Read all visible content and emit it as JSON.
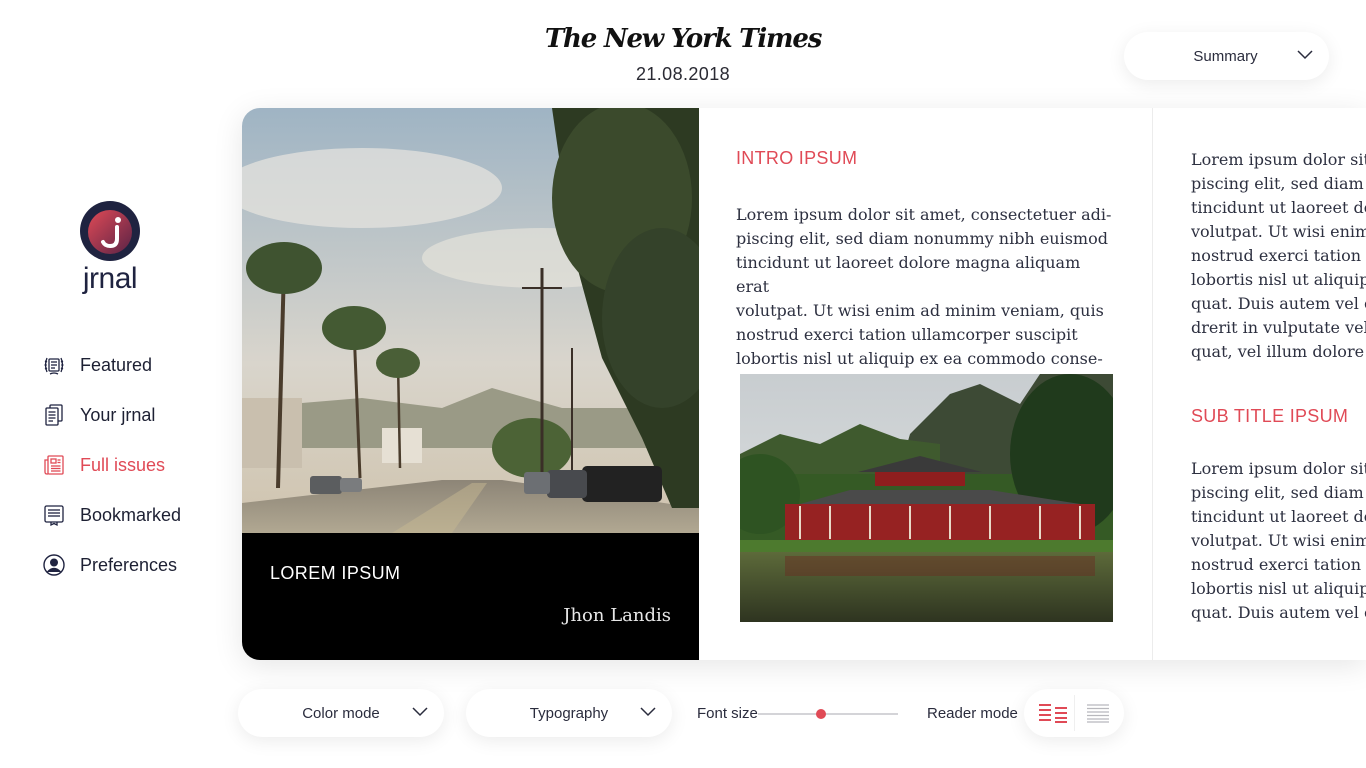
{
  "header": {
    "masthead": "The New York Times",
    "date": "21.08.2018",
    "view_select": "Summary"
  },
  "sidebar": {
    "brand": "jrnal",
    "items": [
      {
        "label": "Featured",
        "icon": "laurel-newspaper-icon",
        "active": false
      },
      {
        "label": "Your jrnal",
        "icon": "stacked-pages-icon",
        "active": false
      },
      {
        "label": "Full issues",
        "icon": "newspaper-icon",
        "active": true
      },
      {
        "label": "Bookmarked",
        "icon": "bookmark-document-icon",
        "active": false
      },
      {
        "label": "Preferences",
        "icon": "user-circle-icon",
        "active": false
      }
    ]
  },
  "article": {
    "hero_title": "LOREM IPSUM",
    "author": "Jhon Landis",
    "intro_heading": "INTRO IPSUM",
    "intro_body": "Lorem ipsum dolor sit amet, consectetuer adi-\npiscing elit, sed diam nonummy nibh euismod\ntincidunt ut laoreet dolore magna aliquam erat\nvolutpat. Ut wisi enim ad minim veniam, quis\nnostrud exerci tation ullamcorper suscipit\nlobortis nisl ut aliquip ex ea commodo conse-",
    "col2_body_1": "Lorem ipsum dolor sit\npiscing elit, sed diam n\ntincidunt ut laoreet do\nvolutpat. Ut wisi enim\nnostrud exerci tation u\nlobortis nisl ut aliquip\nquat. Duis autem vel e\ndrerit in vulputate veli\nquat, vel illum dolore e",
    "sub_heading": "SUB TITLE IPSUM",
    "col2_body_2": "Lorem ipsum dolor sit\npiscing elit, sed diam n\ntincidunt ut laoreet do\nvolutpat. Ut wisi enim\nnostrud exerci tation u\nlobortis nisl ut aliquip\nquat. Duis autem vel e"
  },
  "toolbar": {
    "color_mode": "Color mode",
    "typography": "Typography",
    "font_size_label": "Font size",
    "font_size_level": 0.45,
    "reader_mode_label": "Reader mode",
    "reader_mode_selected": "columns"
  },
  "colors": {
    "accent": "#e04a56",
    "text": "#1d2033",
    "logo_dark": "#1f2340"
  }
}
